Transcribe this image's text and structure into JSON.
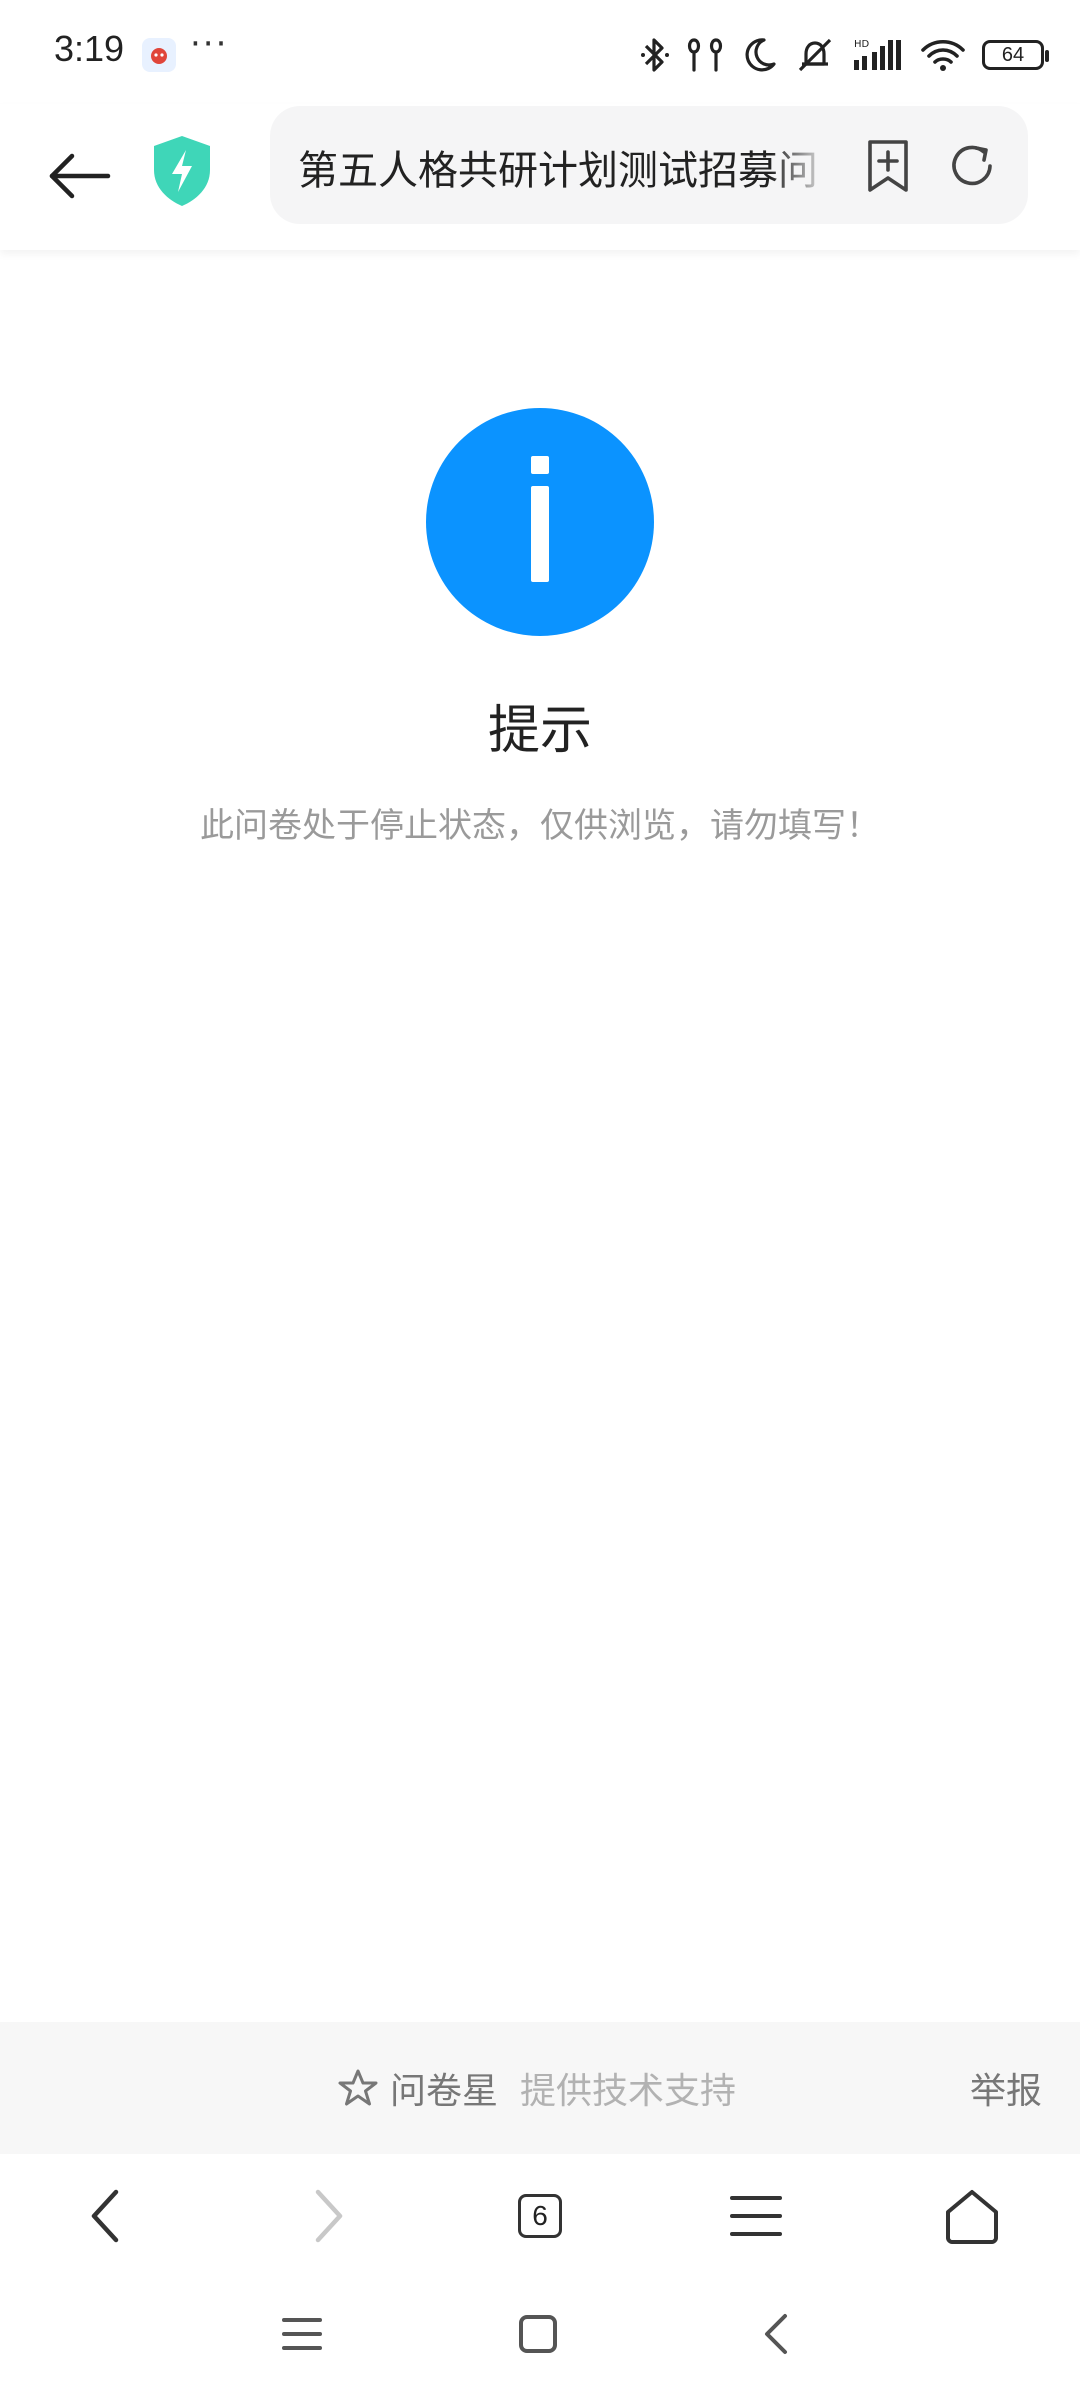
{
  "status_bar": {
    "time": "3:19",
    "overflow_dots": "···",
    "battery_level": "64",
    "icons": [
      "bluetooth-icon",
      "earbuds-icon",
      "moon-icon",
      "mute-icon",
      "signal-icon",
      "wifi-icon",
      "battery-icon"
    ]
  },
  "browser": {
    "address_text": "第五人格共研计划测试招募问",
    "tab_count": "6"
  },
  "main": {
    "title": "提示",
    "message": "此问卷处于停止状态，仅供浏览，请勿填写！"
  },
  "footer": {
    "brand_name": "问卷星",
    "brand_support": "提供技术支持",
    "report_label": "举报"
  },
  "colors": {
    "info_blue": "#0b93ff",
    "shield_teal": "#3fd6b8"
  }
}
